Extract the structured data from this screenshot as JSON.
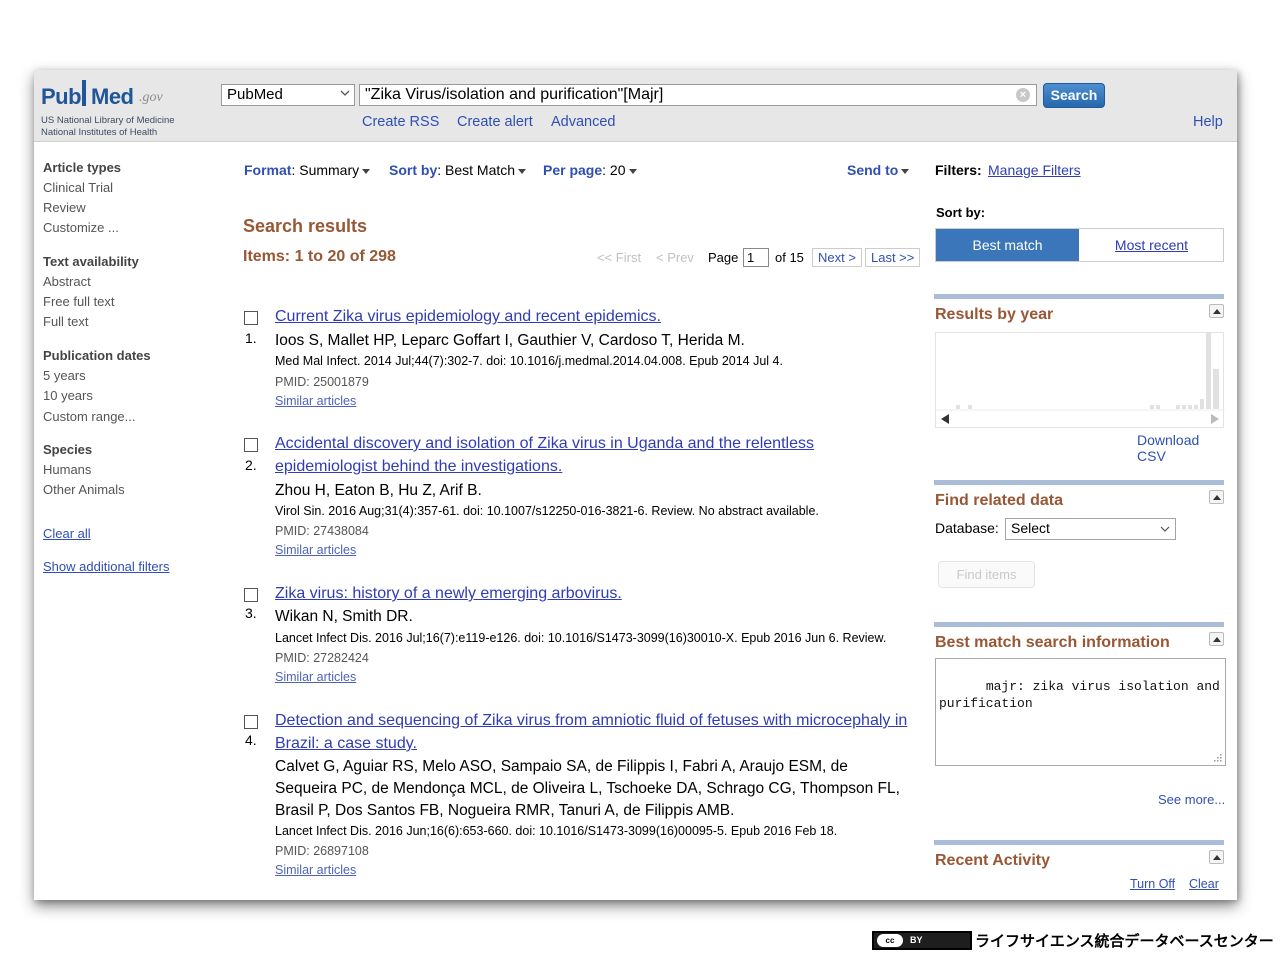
{
  "header": {
    "logo": {
      "pub": "Pub",
      "med": "Med",
      "gov": ".gov",
      "line1": "US National Library of Medicine",
      "line2": "National Institutes of Health"
    },
    "database_select": "PubMed",
    "query": "\"Zika Virus/isolation and purification\"[Majr]",
    "search_label": "Search",
    "links": [
      "Create RSS",
      "Create alert",
      "Advanced"
    ],
    "help": "Help"
  },
  "sidebar": {
    "article_types": {
      "heading": "Article types",
      "items": [
        "Clinical Trial",
        "Review",
        "Customize ..."
      ]
    },
    "text_availability": {
      "heading": "Text availability",
      "items": [
        "Abstract",
        "Free full text",
        "Full text"
      ]
    },
    "publication_dates": {
      "heading": "Publication dates",
      "items": [
        "5 years",
        "10 years",
        "Custom range..."
      ]
    },
    "species": {
      "heading": "Species",
      "items": [
        "Humans",
        "Other Animals"
      ]
    },
    "clear_all": "Clear all",
    "show_filters": "Show additional filters"
  },
  "toolbar": {
    "format_label": "Format",
    "format_value": ": Summary",
    "sort_label": "Sort by",
    "sort_value": ": Best Match",
    "perpage_label": "Per page",
    "perpage_value": ": 20",
    "send_to": "Send to"
  },
  "results": {
    "title": "Search results",
    "items": "Items: 1 to 20 of 298",
    "pager": {
      "first": "<< First",
      "prev": "< Prev",
      "page_label": "Page",
      "page": "1",
      "of": "of 15",
      "next": "Next >",
      "last": "Last >>"
    },
    "list": [
      {
        "num": "1.",
        "title_lines": [
          "Current Zika virus epidemiology and recent epidemics."
        ],
        "author_lines": [
          "Ioos S, Mallet HP, Leparc Goffart I, Gauthier V, Cardoso T, Herida M."
        ],
        "source": "Med Mal Infect. 2014 Jul;44(7):302-7. doi: 10.1016/j.medmal.2014.04.008. Epub 2014 Jul 4.",
        "pmid": "PMID: 25001879",
        "similar": "Similar articles"
      },
      {
        "num": "2.",
        "title_lines": [
          "Accidental discovery and isolation of Zika virus in Uganda and the relentless",
          "epidemiologist behind the investigations."
        ],
        "author_lines": [
          "Zhou H, Eaton B, Hu Z, Arif B."
        ],
        "source": "Virol Sin. 2016 Aug;31(4):357-61. doi: 10.1007/s12250-016-3821-6. Review. No abstract available.",
        "pmid": "PMID: 27438084",
        "similar": "Similar articles"
      },
      {
        "num": "3.",
        "title_lines": [
          "Zika virus: history of a newly emerging arbovirus."
        ],
        "author_lines": [
          "Wikan N, Smith DR."
        ],
        "source": "Lancet Infect Dis. 2016 Jul;16(7):e119-e126. doi: 10.1016/S1473-3099(16)30010-X. Epub 2016 Jun 6. Review.",
        "pmid": "PMID: 27282424",
        "similar": "Similar articles"
      },
      {
        "num": "4.",
        "title_lines": [
          "Detection and sequencing of Zika virus from amniotic fluid of fetuses with microcephaly in",
          "Brazil: a case study."
        ],
        "author_lines": [
          "Calvet G, Aguiar RS, Melo ASO, Sampaio SA, de Filippis I, Fabri A, Araujo ESM, de",
          "Sequeira PC, de Mendonça MCL, de Oliveira L, Tschoeke DA, Schrago CG, Thompson FL,",
          "Brasil P, Dos Santos FB, Nogueira RMR, Tanuri A, de Filippis AMB."
        ],
        "source": "Lancet Infect Dis. 2016 Jun;16(6):653-660. doi: 10.1016/S1473-3099(16)00095-5. Epub 2016 Feb 18.",
        "pmid": "PMID: 26897108",
        "similar": "Similar articles"
      }
    ]
  },
  "right": {
    "filters_label": "Filters:",
    "manage_filters": "Manage Filters",
    "sort_by": "Sort by:",
    "best_match": "Best match",
    "most_recent": "Most recent",
    "results_by_year": "Results by year",
    "download_csv": "Download CSV",
    "find_related": "Find related data",
    "database_label": "Database:",
    "database_value": "Select",
    "find_items": "Find items",
    "best_match_info": "Best match search information",
    "best_match_query": "majr: zika virus isolation and\npurification",
    "see_more": "See more...",
    "recent_activity": "Recent Activity",
    "turn_off": "Turn Off",
    "clear": "Clear"
  },
  "footer": {
    "cc": "cc",
    "by": "BY",
    "credit": "ライフサイエンス統合データベースセンター"
  },
  "colors": {
    "accent_blue": "#3a76b9",
    "heading_brown": "#985735",
    "link": "#2f3cb5",
    "header_bg": "#e7e7e7"
  }
}
